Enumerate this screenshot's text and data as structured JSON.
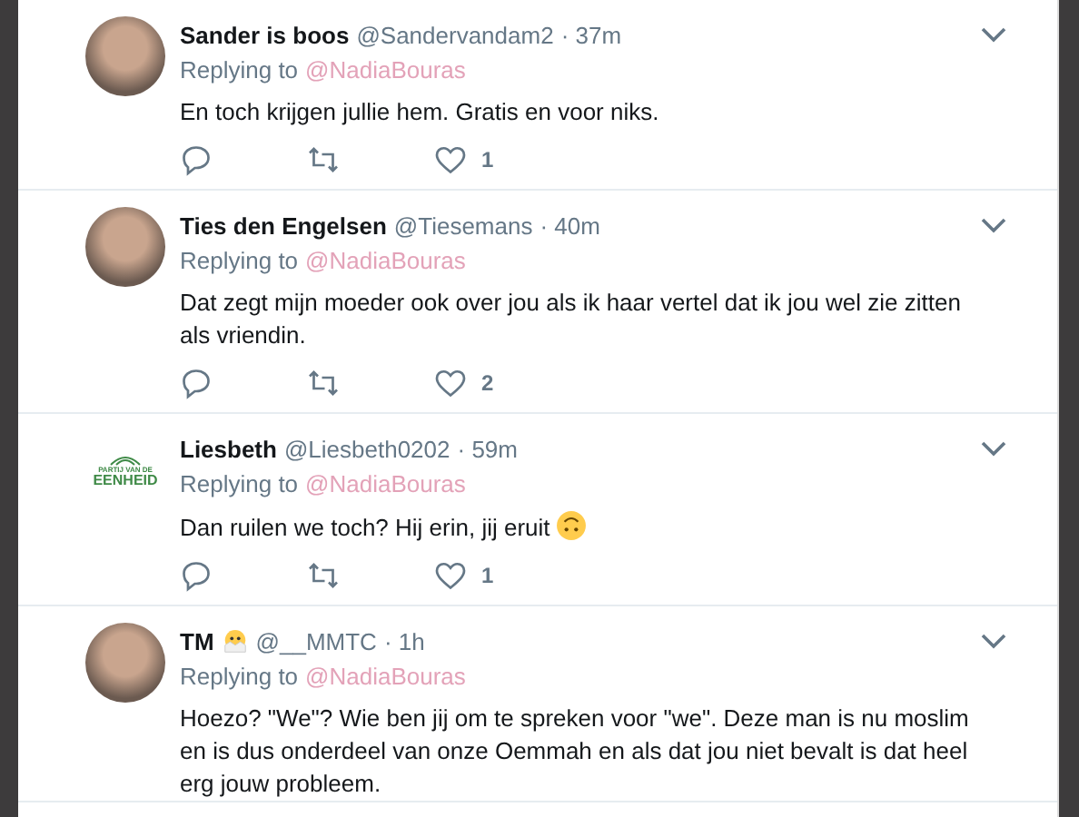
{
  "tweets": [
    {
      "name": "Sander is boos",
      "handle": "@Sandervandam2",
      "time": "· 37m",
      "avatar": {
        "kind": "photo"
      },
      "name_emoji": false,
      "replying_label": "Replying to",
      "replying_to": "@NadiaBouras",
      "text": "En toch krijgen jullie hem. Gratis en voor niks.",
      "text_emoji": false,
      "actions": {
        "like_count": "1"
      }
    },
    {
      "name": "Ties den Engelsen",
      "handle": "@Tiesemans",
      "time": "· 40m",
      "avatar": {
        "kind": "photo"
      },
      "name_emoji": false,
      "replying_label": "Replying to",
      "replying_to": "@NadiaBouras",
      "text": "Dat zegt mijn moeder ook over jou als ik haar vertel dat ik jou wel zie zitten als vriendin.",
      "text_emoji": false,
      "actions": {
        "like_count": "2"
      }
    },
    {
      "name": "Liesbeth",
      "handle": "@Liesbeth0202",
      "time": "· 59m",
      "avatar": {
        "kind": "logo",
        "line_1": "PARTIJ VAN DE",
        "line_2": "EENHEID"
      },
      "name_emoji": false,
      "replying_label": "Replying to",
      "replying_to": "@NadiaBouras",
      "text": "Dan ruilen we toch? Hij erin, jij eruit",
      "text_emoji": true,
      "actions": {
        "like_count": "1"
      }
    },
    {
      "name": "TM",
      "handle": "@__MMTC",
      "time": "· 1h",
      "avatar": {
        "kind": "photo"
      },
      "name_emoji": true,
      "replying_label": "Replying to",
      "replying_to": "@NadiaBouras",
      "text": "Hoezo? \"We\"? Wie ben jij om te spreken voor \"we\". Deze man is nu moslim en is dus onderdeel van onze Oemmah en als dat jou niet bevalt is dat heel erg jouw probleem.",
      "text_emoji": false
    }
  ]
}
